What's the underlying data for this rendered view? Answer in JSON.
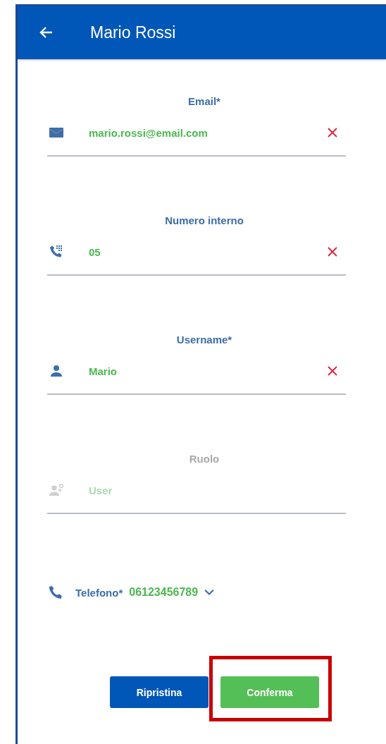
{
  "header": {
    "title": "Mario Rossi"
  },
  "fields": [
    {
      "label": "Email*",
      "value": "mario.rossi@email.com",
      "disabled": false,
      "clearable": true
    },
    {
      "label": "Numero interno",
      "value": "05",
      "disabled": false,
      "clearable": true
    },
    {
      "label": "Username*",
      "value": "Mario",
      "disabled": false,
      "clearable": true
    },
    {
      "label": "Ruolo",
      "value": "User",
      "disabled": true,
      "clearable": false
    }
  ],
  "phone": {
    "label": "Telefono*",
    "value": "06123456789"
  },
  "buttons": [
    {
      "label": "Ripristina",
      "kind": "secondary",
      "highlighted": false
    },
    {
      "label": "Conferma",
      "kind": "primary",
      "highlighted": true
    }
  ]
}
